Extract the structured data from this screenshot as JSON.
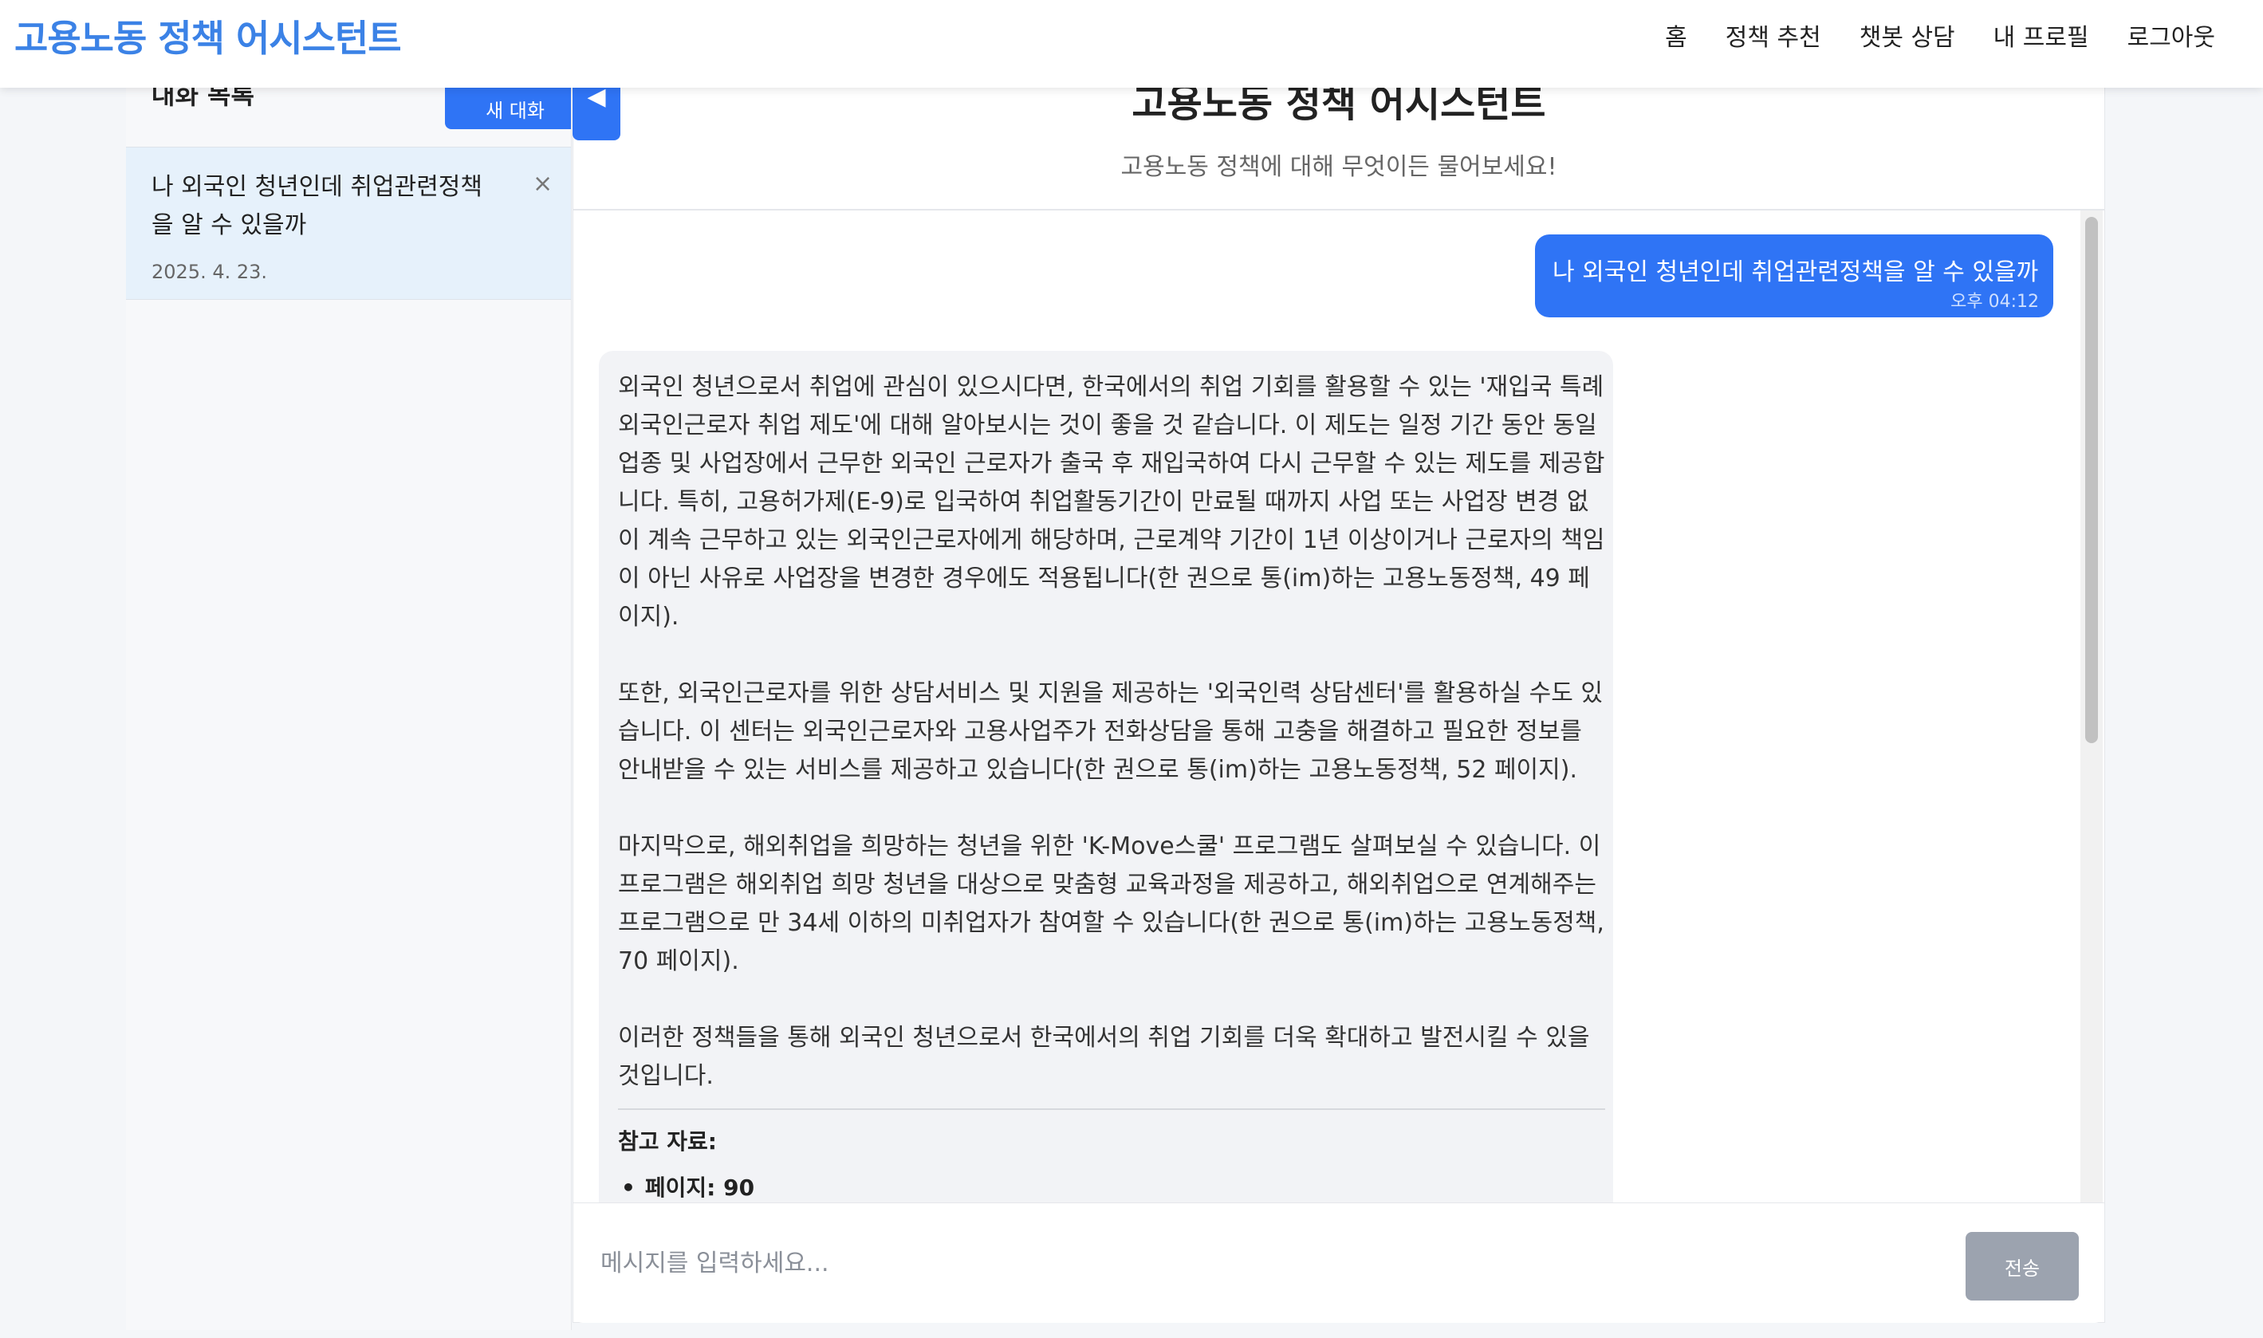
{
  "nav": {
    "brand": "고용노동 정책 어시스턴트",
    "links": [
      "홈",
      "정책 추천",
      "챗봇 상담",
      "내 프로필",
      "로그아웃"
    ]
  },
  "sidebar": {
    "title": "대화 목록",
    "new_chat_label": "새 대화",
    "conversations": [
      {
        "title": "나 외국인 청년인데 취업관련정책을 알 수 있을까",
        "date": "2025. 4. 23."
      }
    ],
    "close_symbol": "×"
  },
  "collapse_symbol": "◀",
  "chat": {
    "title": "고용노동 정책 어시스턴트",
    "subtitle": "고용노동 정책에 대해 무엇이든 물어보세요!",
    "user_message": {
      "text": "나 외국인 청년인데 취업관련정책을 알 수 있을까",
      "time": "오후 04:12"
    },
    "bot_message": {
      "text": "외국인 청년으로서 취업에 관심이 있으시다면, 한국에서의 취업 기회를 활용할 수 있는 '재입국 특례 외국인근로자 취업 제도'에 대해 알아보시는 것이 좋을 것 같습니다. 이 제도는 일정 기간 동안 동일 업종 및 사업장에서 근무한 외국인 근로자가 출국 후 재입국하여 다시 근무할 수 있는 제도를 제공합니다. 특히, 고용허가제(E-9)로 입국하여 취업활동기간이 만료될 때까지 사업 또는 사업장 변경 없이 계속 근무하고 있는 외국인근로자에게 해당하며, 근로계약 기간이 1년 이상이거나 근로자의 책임이 아닌 사유로 사업장을 변경한 경우에도 적용됩니다(한 권으로 통(im)하는 고용노동정책, 49 페이지).\n\n또한, 외국인근로자를 위한 상담서비스 및 지원을 제공하는 '외국인력 상담센터'를 활용하실 수도 있습니다. 이 센터는 외국인근로자와 고용사업주가 전화상담을 통해 고충을 해결하고 필요한 정보를 안내받을 수 있는 서비스를 제공하고 있습니다(한 권으로 통(im)하는 고용노동정책, 52 페이지).\n\n마지막으로, 해외취업을 희망하는 청년을 위한 'K-Move스쿨' 프로그램도 살펴보실 수 있습니다. 이 프로그램은 해외취업 희망 청년을 대상으로 맞춤형 교육과정을 제공하고, 해외취업으로 연계해주는 프로그램으로 만 34세 이하의 미취업자가 참여할 수 있습니다(한 권으로 통(im)하는 고용노동정책, 70 페이지).\n\n이러한 정책들을 통해 외국인 청년으로서 한국에서의 취업 기회를 더욱 확대하고 발전시킬 수 있을 것입니다.",
      "references_title": "참고 자료:",
      "references": [
        "페이지: 90"
      ]
    },
    "input_placeholder": "메시지를 입력하세요...",
    "send_label": "전송"
  },
  "colors": {
    "brand": "#3b82e6",
    "primary_button": "#2f74f5",
    "user_bubble": "#2f74f5",
    "bot_bubble": "#f2f3f6",
    "selected_conversation": "#e6f1fb",
    "send_button_disabled": "#9ca3af"
  }
}
